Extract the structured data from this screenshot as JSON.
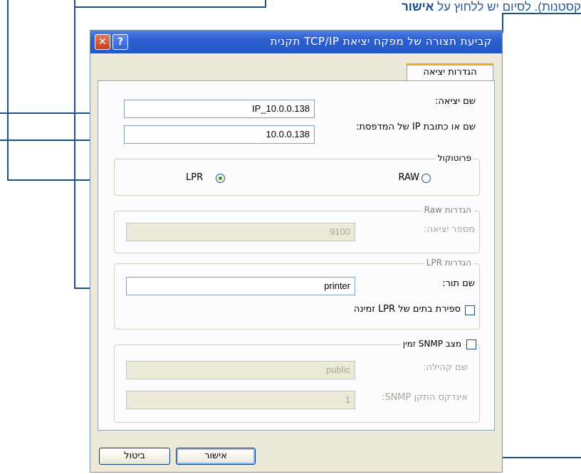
{
  "caption": {
    "prefix": "קסטנות). לסיום יש ללחוץ על ",
    "bold": "אישור"
  },
  "window": {
    "title": "קביעת תצורה של מפקח יציאת TCP/IP תקנית",
    "help_glyph": "?",
    "close_glyph": "✕"
  },
  "tab": {
    "label": "הגדרות יציאה"
  },
  "port_name": {
    "label": "שם יציאה:",
    "value": "IP_10.0.0.138"
  },
  "printer_address": {
    "label": "שם או כתובת IP של המדפסת:",
    "value": "10.0.0.138"
  },
  "protocol": {
    "legend": "פרוטוקול",
    "raw_label": "RAW",
    "lpr_label": "LPR",
    "selected": "LPR"
  },
  "raw_settings": {
    "legend": "הגדרות Raw",
    "port_number_label": "מספר יציאה:",
    "port_number_value": "9100"
  },
  "lpr_settings": {
    "legend": "הגדרות LPR",
    "queue_name_label": "שם תור:",
    "queue_name_value": "printer",
    "byte_counting_label": "ספירת בתים של LPR זמינה",
    "byte_counting_checked": false
  },
  "snmp": {
    "legend": "מצב SNMP זמין",
    "enabled": false,
    "community_label": "שם קהילה:",
    "community_value": "public",
    "device_index_label": "אינדקס התקן SNMP:",
    "device_index_value": "1"
  },
  "buttons": {
    "ok": "אישור",
    "cancel": "ביטול"
  },
  "colors": {
    "accent": "#1d4f8c",
    "titlebar": "#2458c8",
    "tab_highlight": "#f4a622"
  }
}
